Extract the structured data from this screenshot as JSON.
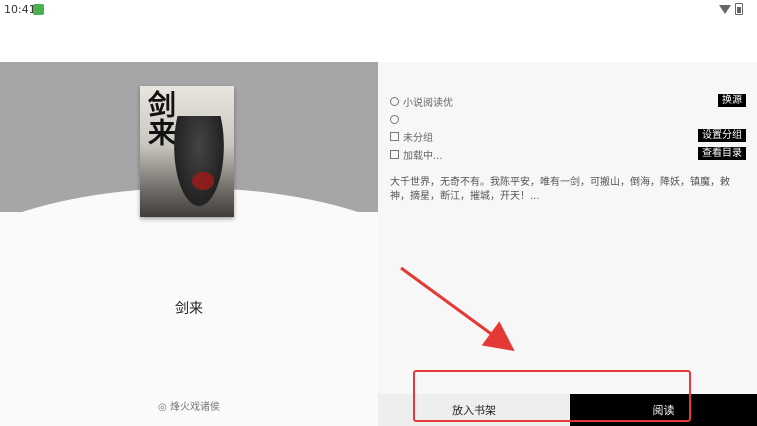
{
  "status_bar": {
    "time": "10:41"
  },
  "book": {
    "cover_text": "剑来",
    "title": "剑来",
    "author": "烽火戏诸侯"
  },
  "info": {
    "source": {
      "label": "小说阅读优",
      "button": "换源"
    },
    "compass": {
      "label": ""
    },
    "group": {
      "label": "未分组",
      "button": "设置分组"
    },
    "toc": {
      "label": "加载中...",
      "button": "查看目录"
    }
  },
  "intro": "大千世界，无奇不有。我陈平安，唯有一剑，可搬山，倒海，降妖，镇魔，敕神，摘星，断江，摧城，开天！...",
  "actions": {
    "add_to_shelf": "放入书架",
    "read": "阅读"
  },
  "annotation": {
    "color": "#e53935"
  }
}
